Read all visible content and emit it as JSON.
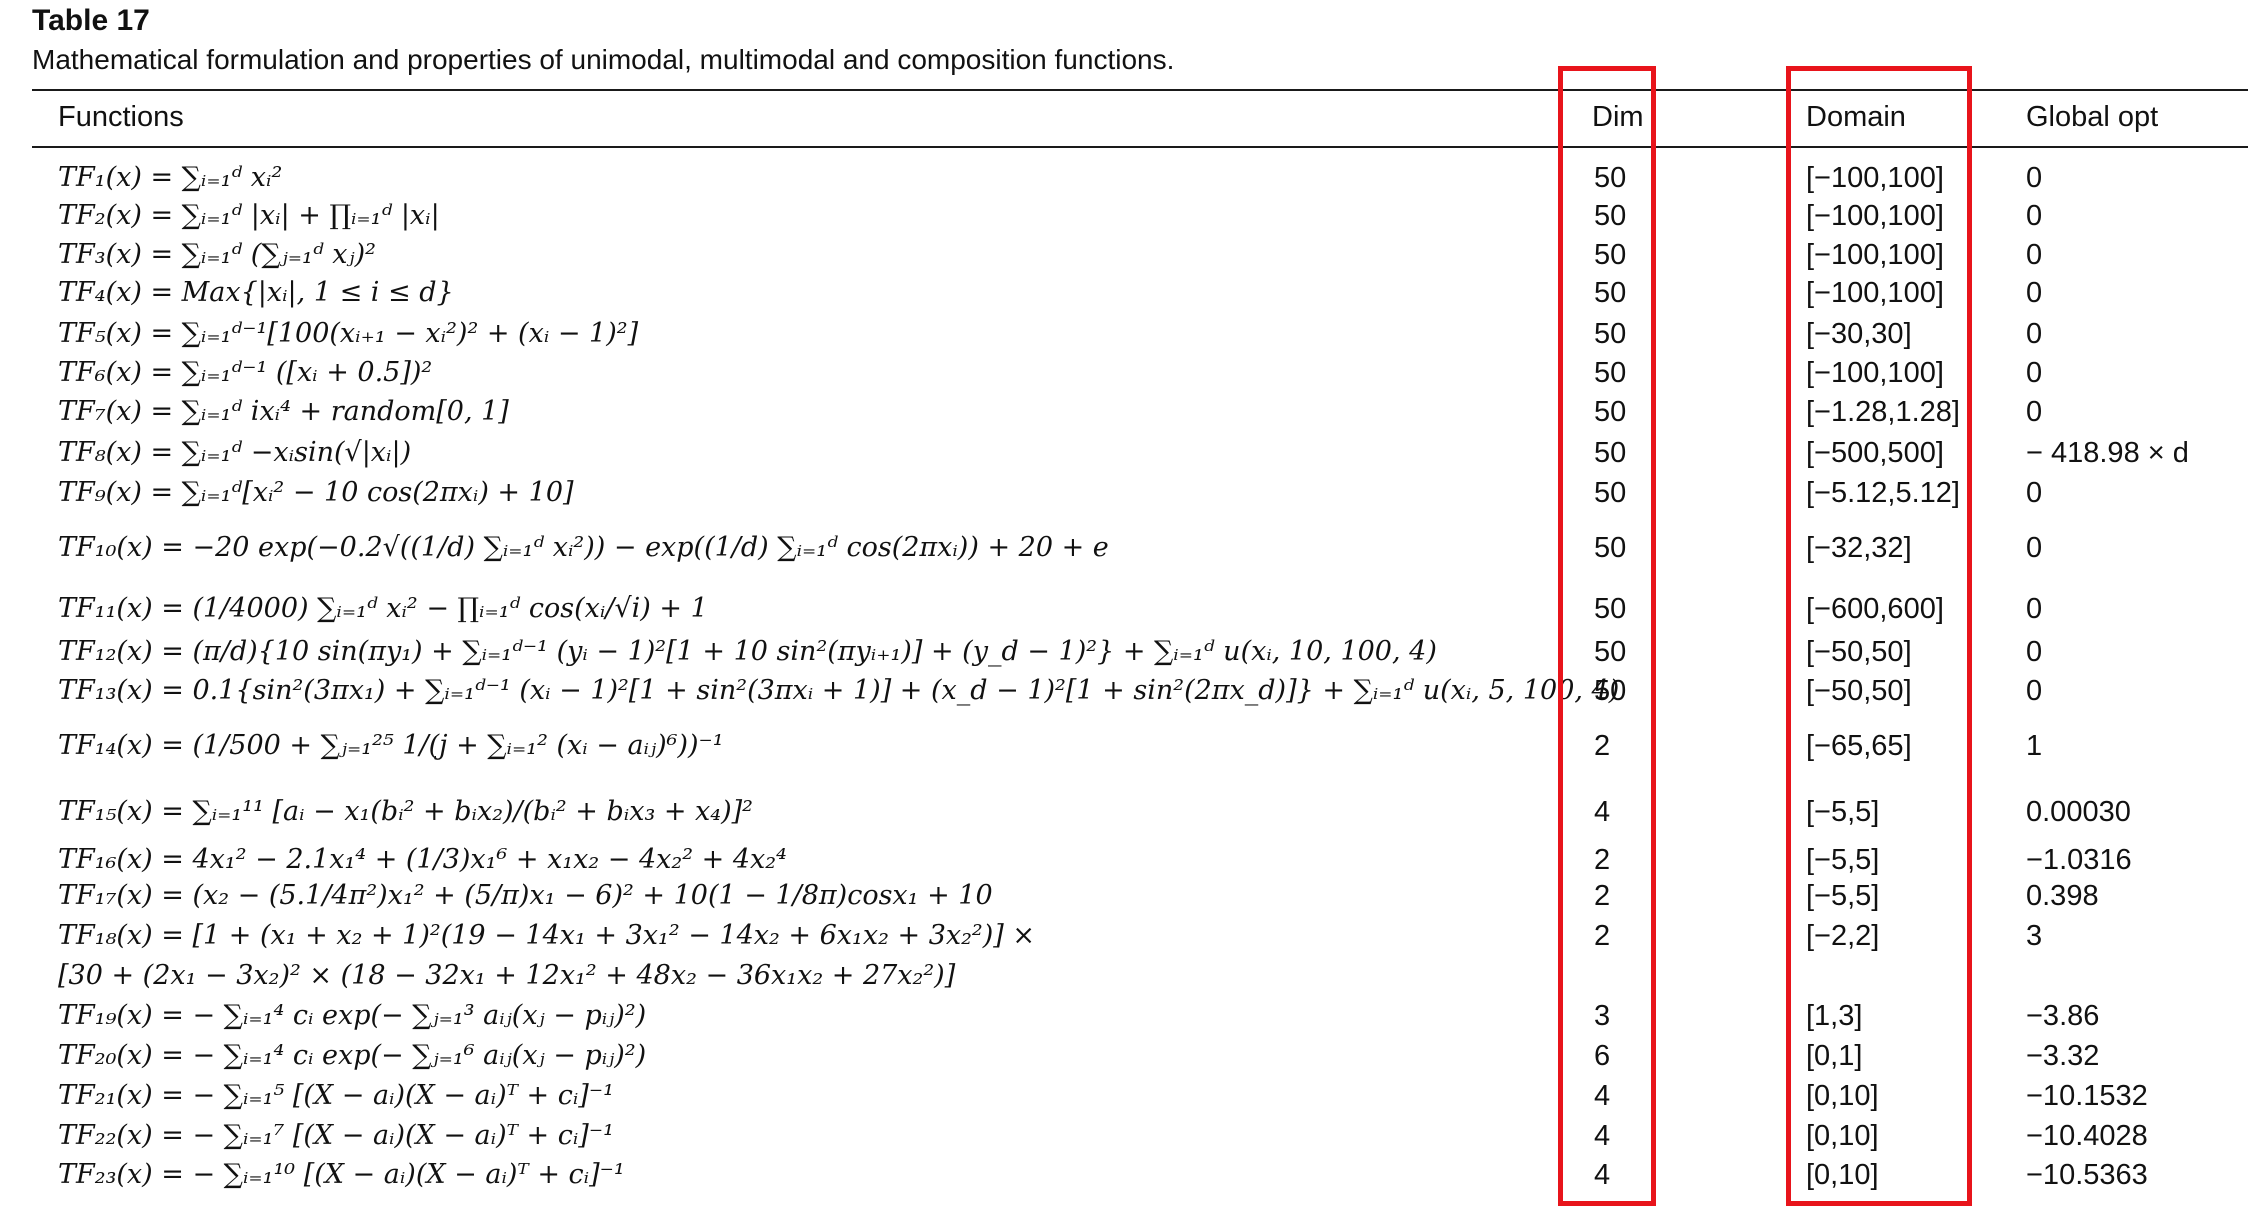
{
  "table": {
    "title": "Table 17",
    "caption": "Mathematical formulation and properties of unimodal, multimodal and composition functions.",
    "headers": {
      "functions": "Functions",
      "dim": "Dim",
      "domain": "Domain",
      "global_opt": "Global opt"
    },
    "rows": [
      {
        "fn": "TF₁(x) = ∑ᵢ₌₁ᵈ xᵢ²",
        "dim": "50",
        "domain": "[−100,100]",
        "opt": "0"
      },
      {
        "fn": "TF₂(x) = ∑ᵢ₌₁ᵈ |xᵢ| + ∏ᵢ₌₁ᵈ |xᵢ|",
        "dim": "50",
        "domain": "[−100,100]",
        "opt": "0"
      },
      {
        "fn": "TF₃(x) = ∑ᵢ₌₁ᵈ (∑ⱼ₌₁ᵈ xⱼ)²",
        "dim": "50",
        "domain": "[−100,100]",
        "opt": "0"
      },
      {
        "fn": "TF₄(x) = Max{|xᵢ|, 1 ≤ i ≤ d}",
        "dim": "50",
        "domain": "[−100,100]",
        "opt": "0"
      },
      {
        "fn": "TF₅(x) = ∑ᵢ₌₁ᵈ⁻¹[100(xᵢ₊₁ − xᵢ²)² + (xᵢ − 1)²]",
        "dim": "50",
        "domain": "[−30,30]",
        "opt": "0"
      },
      {
        "fn": "TF₆(x) = ∑ᵢ₌₁ᵈ⁻¹ ([xᵢ + 0.5])²",
        "dim": "50",
        "domain": "[−100,100]",
        "opt": "0"
      },
      {
        "fn": "TF₇(x) = ∑ᵢ₌₁ᵈ ixᵢ⁴ + random[0, 1]",
        "dim": "50",
        "domain": "[−1.28,1.28]",
        "opt": "0"
      },
      {
        "fn": "TF₈(x) = ∑ᵢ₌₁ᵈ −xᵢsin(√|xᵢ|)",
        "dim": "50",
        "domain": "[−500,500]",
        "opt": "− 418.98 × d"
      },
      {
        "fn": "TF₉(x) = ∑ᵢ₌₁ᵈ[xᵢ² − 10 cos(2πxᵢ) + 10]",
        "dim": "50",
        "domain": "[−5.12,5.12]",
        "opt": "0"
      },
      {
        "fn": "TF₁₀(x) = −20 exp(−0.2√((1/d) ∑ᵢ₌₁ᵈ xᵢ²)) − exp((1/d) ∑ᵢ₌₁ᵈ cos(2πxᵢ)) + 20 + e",
        "dim": "50",
        "domain": "[−32,32]",
        "opt": "0"
      },
      {
        "fn": "TF₁₁(x) = (1/4000) ∑ᵢ₌₁ᵈ xᵢ² − ∏ᵢ₌₁ᵈ cos(xᵢ/√i) + 1",
        "dim": "50",
        "domain": "[−600,600]",
        "opt": "0"
      },
      {
        "fn": "TF₁₂(x) = (π/d){10 sin(πy₁) + ∑ᵢ₌₁ᵈ⁻¹ (yᵢ − 1)²[1 + 10 sin²(πyᵢ₊₁)] + (y_d − 1)²} + ∑ᵢ₌₁ᵈ u(xᵢ, 10, 100, 4)",
        "dim": "50",
        "domain": "[−50,50]",
        "opt": "0"
      },
      {
        "fn": "TF₁₃(x) = 0.1{sin²(3πx₁) + ∑ᵢ₌₁ᵈ⁻¹ (xᵢ − 1)²[1 + sin²(3πxᵢ + 1)] + (x_d − 1)²[1 + sin²(2πx_d)]} + ∑ᵢ₌₁ᵈ u(xᵢ, 5, 100, 4)",
        "dim": "50",
        "domain": "[−50,50]",
        "opt": "0"
      },
      {
        "fn": "TF₁₄(x) = (1/500 + ∑ⱼ₌₁²⁵ 1/(j + ∑ᵢ₌₁² (xᵢ − aᵢⱼ)⁶))⁻¹",
        "dim": "2",
        "domain": "[−65,65]",
        "opt": "1"
      },
      {
        "fn": "TF₁₅(x) = ∑ᵢ₌₁¹¹ [aᵢ − x₁(bᵢ² + bᵢx₂)/(bᵢ² + bᵢx₃ + x₄)]²",
        "dim": "4",
        "domain": "[−5,5]",
        "opt": "0.00030"
      },
      {
        "fn": "TF₁₆(x) = 4x₁² − 2.1x₁⁴ + (1/3)x₁⁶ + x₁x₂ − 4x₂² + 4x₂⁴",
        "dim": "2",
        "domain": "[−5,5]",
        "opt": "−1.0316"
      },
      {
        "fn": "TF₁₇(x) = (x₂ − (5.1/4π²)x₁² + (5/π)x₁ − 6)² + 10(1 − 1/8π)cosx₁ + 10",
        "dim": "2",
        "domain": "[−5,5]",
        "opt": "0.398"
      },
      {
        "fn": "TF₁₈(x) = [1 + (x₁ + x₂ + 1)²(19 − 14x₁ + 3x₁² − 14x₂ + 6x₁x₂ + 3x₂²)] ×",
        "dim": "2",
        "domain": "[−2,2]",
        "opt": "3"
      },
      {
        "fn": "[30 + (2x₁ − 3x₂)² × (18 − 32x₁ + 12x₁² + 48x₂ − 36x₁x₂ + 27x₂²)]",
        "dim": "",
        "domain": "",
        "opt": ""
      },
      {
        "fn": "TF₁₉(x) = − ∑ᵢ₌₁⁴ cᵢ exp(− ∑ⱼ₌₁³ aᵢⱼ(xⱼ − pᵢⱼ)²)",
        "dim": "3",
        "domain": "[1,3]",
        "opt": "−3.86"
      },
      {
        "fn": "TF₂₀(x) = − ∑ᵢ₌₁⁴ cᵢ exp(− ∑ⱼ₌₁⁶ aᵢⱼ(xⱼ − pᵢⱼ)²)",
        "dim": "6",
        "domain": "[0,1]",
        "opt": "−3.32"
      },
      {
        "fn": "TF₂₁(x) = − ∑ᵢ₌₁⁵ [(X − aᵢ)(X − aᵢ)ᵀ + cᵢ]⁻¹",
        "dim": "4",
        "domain": "[0,10]",
        "opt": "−10.1532"
      },
      {
        "fn": "TF₂₂(x) = − ∑ᵢ₌₁⁷ [(X − aᵢ)(X − aᵢ)ᵀ + cᵢ]⁻¹",
        "dim": "4",
        "domain": "[0,10]",
        "opt": "−10.4028"
      },
      {
        "fn": "TF₂₃(x) = − ∑ᵢ₌₁¹⁰ [(X − aᵢ)(X − aᵢ)ᵀ + cᵢ]⁻¹",
        "dim": "4",
        "domain": "[0,10]",
        "opt": "−10.5363"
      }
    ]
  }
}
